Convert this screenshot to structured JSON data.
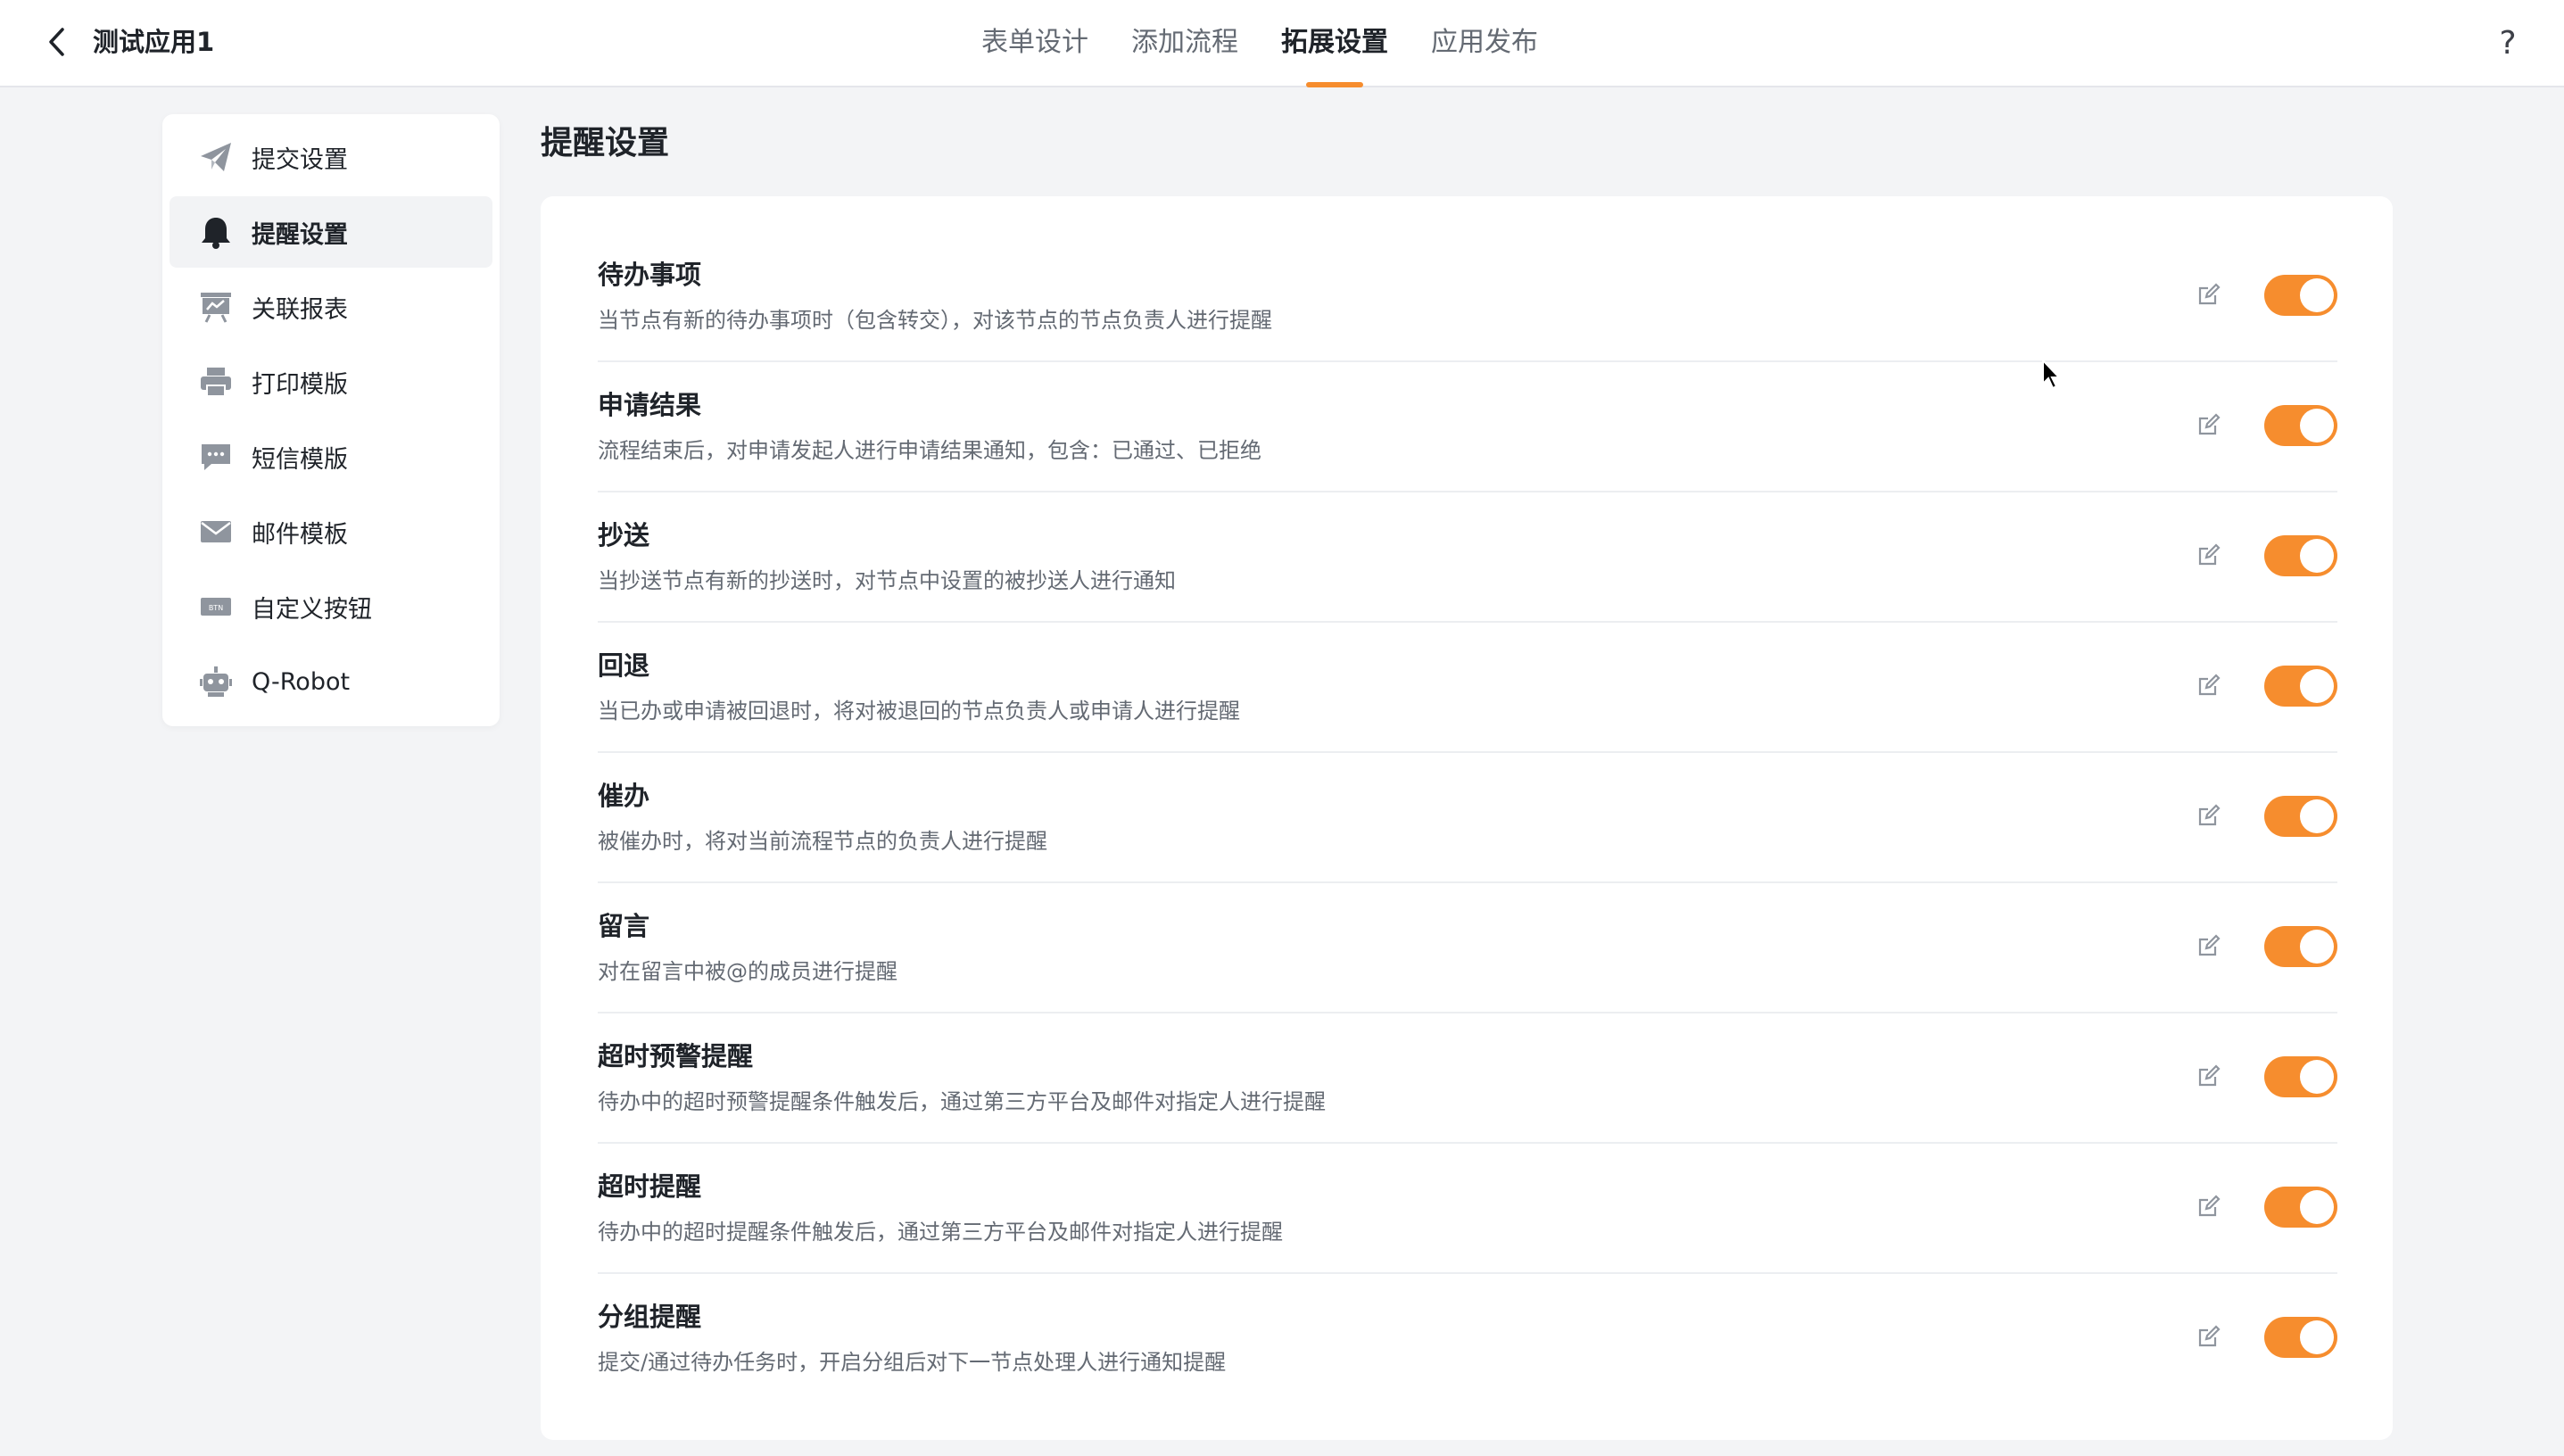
{
  "header": {
    "app_title": "测试应用1",
    "tabs": [
      {
        "label": "表单设计",
        "active": false
      },
      {
        "label": "添加流程",
        "active": false
      },
      {
        "label": "拓展设置",
        "active": true
      },
      {
        "label": "应用发布",
        "active": false
      }
    ],
    "help_label": "?"
  },
  "sidebar": {
    "items": [
      {
        "label": "提交设置",
        "icon": "paper-plane-icon"
      },
      {
        "label": "提醒设置",
        "icon": "bell-icon",
        "active": true
      },
      {
        "label": "关联报表",
        "icon": "chart-board-icon"
      },
      {
        "label": "打印模版",
        "icon": "printer-icon"
      },
      {
        "label": "短信模版",
        "icon": "chat-bubble-icon"
      },
      {
        "label": "邮件模板",
        "icon": "envelope-icon"
      },
      {
        "label": "自定义按钮",
        "icon": "btn-badge-icon"
      },
      {
        "label": "Q-Robot",
        "icon": "robot-icon"
      }
    ]
  },
  "main": {
    "page_title": "提醒设置",
    "rows": [
      {
        "title": "待办事项",
        "desc": "当节点有新的待办事项时（包含转交），对该节点的节点负责人进行提醒",
        "enabled": true
      },
      {
        "title": "申请结果",
        "desc": "流程结束后，对申请发起人进行申请结果通知，包含：已通过、已拒绝",
        "enabled": true
      },
      {
        "title": "抄送",
        "desc": "当抄送节点有新的抄送时，对节点中设置的被抄送人进行通知",
        "enabled": true
      },
      {
        "title": "回退",
        "desc": "当已办或申请被回退时，将对被退回的节点负责人或申请人进行提醒",
        "enabled": true
      },
      {
        "title": "催办",
        "desc": "被催办时，将对当前流程节点的负责人进行提醒",
        "enabled": true
      },
      {
        "title": "留言",
        "desc": "对在留言中被@的成员进行提醒",
        "enabled": true
      },
      {
        "title": "超时预警提醒",
        "desc": "待办中的超时预警提醒条件触发后，通过第三方平台及邮件对指定人进行提醒",
        "enabled": true
      },
      {
        "title": "超时提醒",
        "desc": "待办中的超时提醒条件触发后，通过第三方平台及邮件对指定人进行提醒",
        "enabled": true
      },
      {
        "title": "分组提醒",
        "desc": "提交/通过待办任务时，开启分组后对下一节点处理人进行通知提醒",
        "enabled": true
      }
    ]
  },
  "colors": {
    "accent": "#f68d2e",
    "text_primary": "#1f2329",
    "text_secondary": "#646a73",
    "icon_gray": "#8f959e"
  }
}
